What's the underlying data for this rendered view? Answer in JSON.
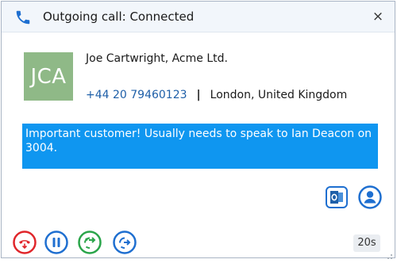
{
  "window": {
    "title": "Outgoing call: Connected",
    "close_label": "×"
  },
  "contact": {
    "initials": "JCA",
    "name_company": "Joe Cartwright, Acme Ltd.",
    "phone": "+44 20 79460123",
    "separator": "|",
    "location": "London, United Kingdom",
    "avatar_color": "#8fb987"
  },
  "note": {
    "text": "Important customer! Usually needs to speak to Ian Deacon on 3004.",
    "background": "#0f96f0"
  },
  "actions": {
    "outlook_icon": "outlook-icon",
    "contact_icon": "contact-card-icon"
  },
  "call_controls": {
    "hangup_icon": "hangup-icon",
    "hold_icon": "pause-icon",
    "transfer_icon": "attended-transfer-icon",
    "blind_transfer_icon": "blind-transfer-icon",
    "duration": "20s",
    "colors": {
      "hangup": "#e0262b",
      "hold": "#1f6fd0",
      "transfer": "#2aa54a",
      "blind": "#1f6fd0"
    }
  }
}
